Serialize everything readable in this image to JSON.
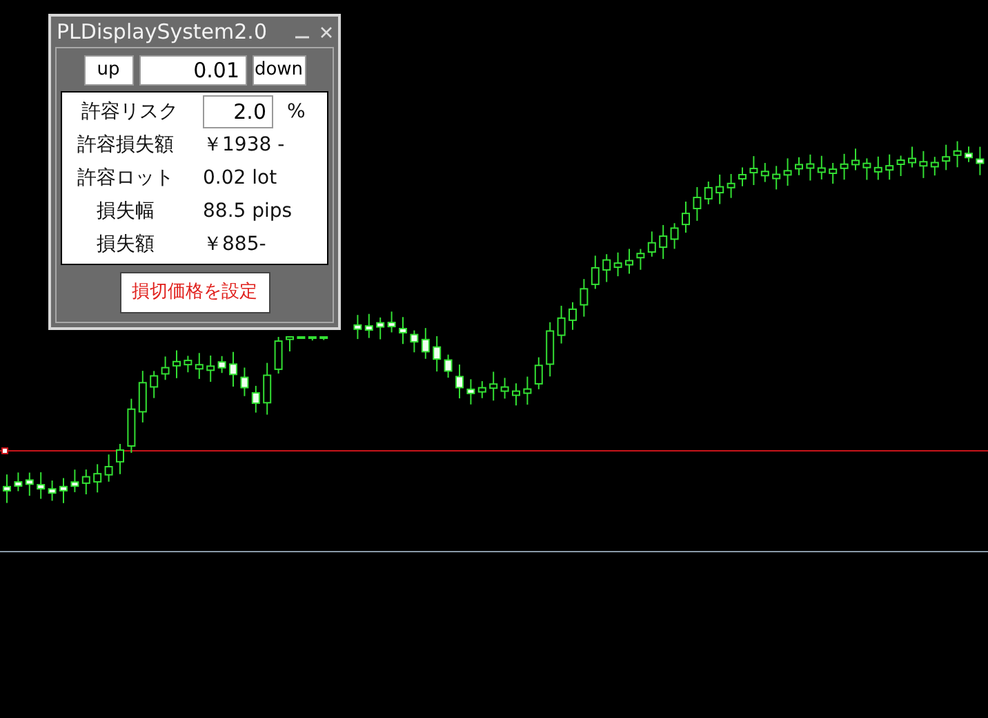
{
  "panel": {
    "title": "PLDisplaySystem2.0",
    "stepper": {
      "up_label": "up",
      "value": "0.01",
      "down_label": "down"
    },
    "rows": [
      {
        "kind": "input",
        "label": "許容リスク",
        "value": "2.0",
        "unit": "%"
      },
      {
        "kind": "text",
        "label": "許容損失額",
        "value": "￥1938 -"
      },
      {
        "kind": "text",
        "label": "許容ロット",
        "value": "0.02 lot"
      },
      {
        "kind": "text",
        "label": "損失幅",
        "value": "88.5 pips"
      },
      {
        "kind": "text",
        "label": "損失額",
        "value": "￥885-"
      }
    ],
    "action_button": "損切価格を設定"
  }
}
